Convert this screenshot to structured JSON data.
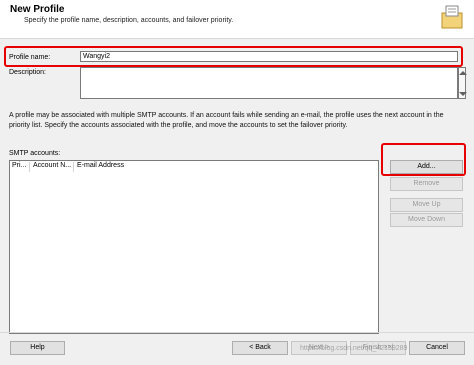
{
  "header": {
    "title": "New Profile",
    "subtitle": "Specify the profile name, description, accounts, and failover priority."
  },
  "profile": {
    "name_label": "Profile name:",
    "name_value": "Wangyi2",
    "description_label": "Description:",
    "description_value": ""
  },
  "info_text": "A profile may be associated with multiple SMTP accounts. If an account fails while sending an e-mail, the profile uses the next account in the priority list. Specify the accounts associated with the profile, and move the accounts to set the failover priority.",
  "smtp": {
    "label": "SMTP accounts:",
    "columns": [
      "Pri...",
      "Account N...",
      "E-mail Address"
    ],
    "rows": []
  },
  "side_buttons": {
    "add": "Add...",
    "remove": "Remove",
    "move_up": "Move Up",
    "move_down": "Move Down"
  },
  "footer": {
    "help": "Help",
    "back": "< Back",
    "next": "Next >",
    "finish": "Finish >>|",
    "cancel": "Cancel"
  },
  "watermark": "https://blog.csdn.net/qq_42159289",
  "colors": {
    "highlight": "#e60000",
    "window_bg": "#f0f0f0"
  }
}
